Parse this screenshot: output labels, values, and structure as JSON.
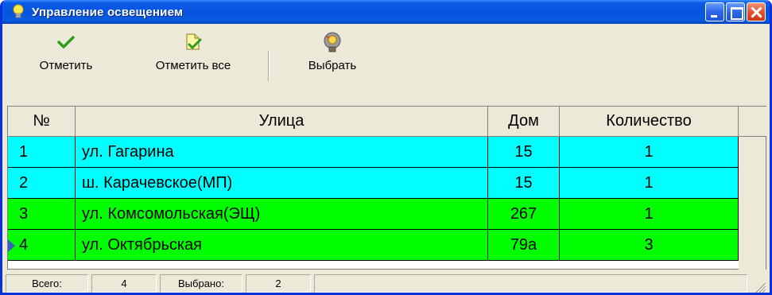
{
  "window": {
    "title": "Управление освещением",
    "title_icon": "lightbulb-icon",
    "controls": [
      "minimize",
      "maximize",
      "close"
    ]
  },
  "toolbar": {
    "mark_label": "Отметить",
    "mark_icon": "checkmark-icon",
    "mark_all_label": "Отметить все",
    "mark_all_icon": "document-check-icon",
    "select_label": "Выбрать",
    "select_icon": "lamp-icon"
  },
  "table": {
    "columns": [
      "№",
      "Улица",
      "Дом",
      "Количество"
    ],
    "rows": [
      {
        "num": "1",
        "street": "ул. Гагарина",
        "house": "15",
        "count": "1",
        "color": "#00ffff"
      },
      {
        "num": "2",
        "street": "ш. Карачевское(МП)",
        "house": "15",
        "count": "1",
        "color": "#00ffff"
      },
      {
        "num": "3",
        "street": "ул. Комсомольская(ЭЩ)",
        "house": "267",
        "count": "1",
        "color": "#00ff00"
      },
      {
        "num": "4",
        "street": "ул. Октябрьская",
        "house": "79а",
        "count": "3",
        "color": "#00ff00",
        "current": true
      }
    ]
  },
  "status": {
    "total_label": "Всего:",
    "total_value": "4",
    "selected_label": "Выбрано:",
    "selected_value": "2"
  },
  "colors": {
    "titlebar": "#0753df",
    "row_cyan": "#00ffff",
    "row_green": "#00ff00",
    "face": "#ece9d8"
  }
}
